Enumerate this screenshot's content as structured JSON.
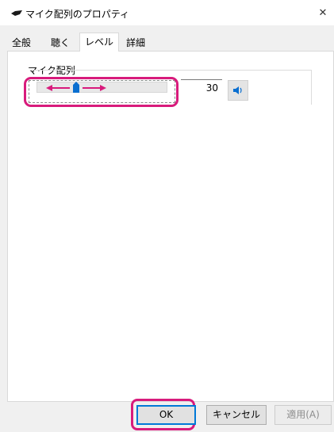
{
  "window": {
    "title": "マイク配列のプロパティ",
    "close_glyph": "✕"
  },
  "tabs": [
    {
      "label": "全般",
      "active": false
    },
    {
      "label": "聴く",
      "active": false
    },
    {
      "label": "レベル",
      "active": true
    },
    {
      "label": "詳細",
      "active": false
    }
  ],
  "level": {
    "group_label": "マイク配列",
    "value": "30",
    "level_percent": 30
  },
  "buttons": {
    "ok": "OK",
    "cancel": "キャンセル",
    "apply": "適用(A)"
  },
  "colors": {
    "highlight": "#d81b7c",
    "accent": "#0078d7",
    "panel_bg": "#f0f0f0"
  }
}
